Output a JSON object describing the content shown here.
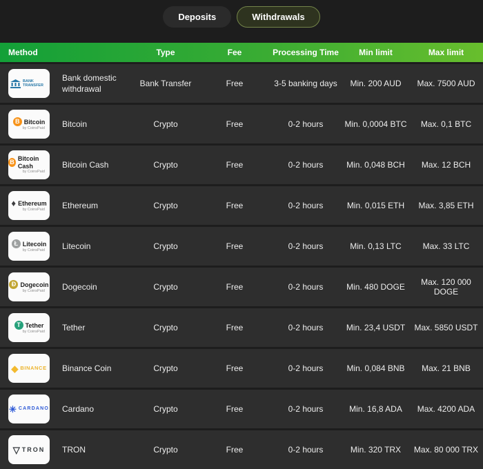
{
  "tabs": {
    "deposits": "Deposits",
    "withdrawals": "Withdrawals"
  },
  "table": {
    "headers": {
      "method": "Method",
      "type": "Type",
      "fee": "Fee",
      "processing": "Processing Time",
      "min": "Min limit",
      "max": "Max limit"
    },
    "rows": [
      {
        "badge": {
          "variant": "bank",
          "icon": "bank-transfer-logo",
          "name": "BANK TRANSFER",
          "sub": "",
          "color": "#2878a8",
          "iconType": "svg",
          "symbol": ""
        },
        "method": "Bank domestic withdrawal",
        "type": "Bank Transfer",
        "fee": "Free",
        "processing": "3-5 banking days",
        "min": "Min. 200 AUD",
        "max": "Max. 7500 AUD"
      },
      {
        "badge": {
          "variant": "coin",
          "icon": "bitcoin-logo",
          "name": "Bitcoin",
          "sub": "by CoinsPaid",
          "color": "#f7931a",
          "iconType": "circle",
          "symbol": "B"
        },
        "method": "Bitcoin",
        "type": "Crypto",
        "fee": "Free",
        "processing": "0-2 hours",
        "min": "Min. 0,0004 BTC",
        "max": "Max. 0,1 BTC"
      },
      {
        "badge": {
          "variant": "coin",
          "icon": "bitcoin-cash-logo",
          "name": "Bitcoin Cash",
          "sub": "by CoinsPaid",
          "color": "#f7931a",
          "iconType": "circle",
          "symbol": "B"
        },
        "method": "Bitcoin Cash",
        "type": "Crypto",
        "fee": "Free",
        "processing": "0-2 hours",
        "min": "Min. 0,048 BCH",
        "max": "Max. 12 BCH"
      },
      {
        "badge": {
          "variant": "coin",
          "icon": "ethereum-logo",
          "name": "Ethereum",
          "sub": "by CoinsPaid",
          "color": "#3d3d3f",
          "iconType": "glyph",
          "symbol": "♦"
        },
        "method": "Ethereum",
        "type": "Crypto",
        "fee": "Free",
        "processing": "0-2 hours",
        "min": "Min. 0,015 ETH",
        "max": "Max. 3,85 ETH"
      },
      {
        "badge": {
          "variant": "coin",
          "icon": "litecoin-logo",
          "name": "Litecoin",
          "sub": "by CoinsPaid",
          "color": "#9ea1a1",
          "iconType": "circle",
          "symbol": "Ł"
        },
        "method": "Litecoin",
        "type": "Crypto",
        "fee": "Free",
        "processing": "0-2 hours",
        "min": "Min. 0,13 LTC",
        "max": "Max. 33 LTC"
      },
      {
        "badge": {
          "variant": "coin",
          "icon": "dogecoin-logo",
          "name": "Dogecoin",
          "sub": "by CoinsPaid",
          "color": "#c2a633",
          "iconType": "circle",
          "symbol": "Ð"
        },
        "method": "Dogecoin",
        "type": "Crypto",
        "fee": "Free",
        "processing": "0-2 hours",
        "min": "Min. 480 DOGE",
        "max": "Max. 120 000 DOGE"
      },
      {
        "badge": {
          "variant": "coin",
          "icon": "tether-logo",
          "name": "Tether",
          "sub": "by CoinsPaid",
          "color": "#26a17b",
          "iconType": "circle",
          "symbol": "T"
        },
        "method": "Tether",
        "type": "Crypto",
        "fee": "Free",
        "processing": "0-2 hours",
        "min": "Min. 23,4 USDT",
        "max": "Max. 5850 USDT"
      },
      {
        "badge": {
          "variant": "binance",
          "icon": "binance-logo",
          "name": "BINANCE",
          "sub": "",
          "color": "#f3ba2f",
          "iconType": "glyph",
          "symbol": "◆"
        },
        "method": "Binance Coin",
        "type": "Crypto",
        "fee": "Free",
        "processing": "0-2 hours",
        "min": "Min. 0,084 BNB",
        "max": "Max. 21 BNB"
      },
      {
        "badge": {
          "variant": "cardano",
          "icon": "cardano-logo",
          "name": "CARDANO",
          "sub": "",
          "color": "#2f5bd7",
          "iconType": "glyph",
          "symbol": "✳"
        },
        "method": "Cardano",
        "type": "Crypto",
        "fee": "Free",
        "processing": "0-2 hours",
        "min": "Min. 16,8 ADA",
        "max": "Max. 4200 ADA"
      },
      {
        "badge": {
          "variant": "tron",
          "icon": "tron-logo",
          "name": "TRON",
          "sub": "",
          "color": "#33383c",
          "iconType": "glyph",
          "symbol": "▽"
        },
        "method": "TRON",
        "type": "Crypto",
        "fee": "Free",
        "processing": "0-2 hours",
        "min": "Min. 320 TRX",
        "max": "Max. 80 000 TRX"
      }
    ]
  },
  "colors": {
    "page_background": "#1d1d1d",
    "row_background": "#2e2e2e",
    "header_gradient_start": "#13a038",
    "header_gradient_end": "#68be2d",
    "active_tab_border": "#74854a",
    "active_tab_background": "#2e331f"
  }
}
